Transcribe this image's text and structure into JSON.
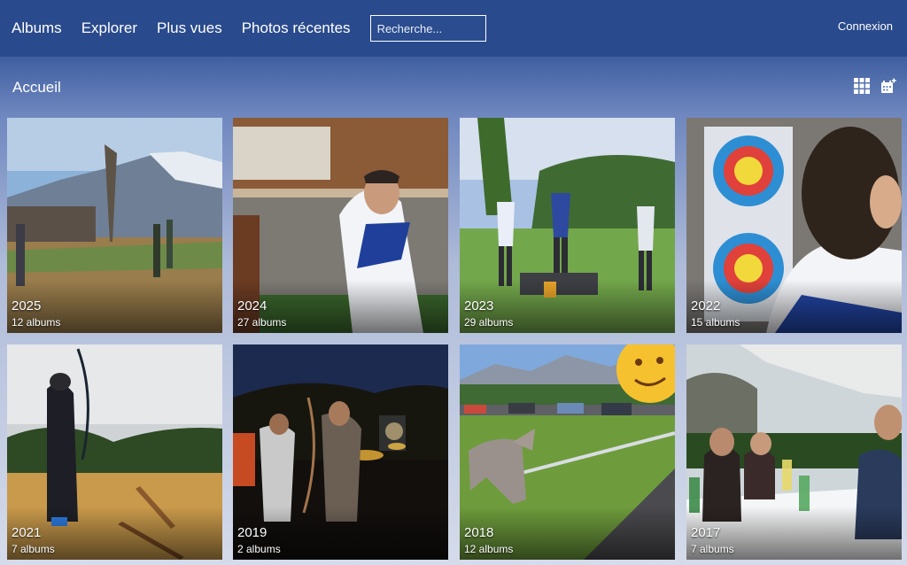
{
  "nav": {
    "links": [
      "Albums",
      "Explorer",
      "Plus vues",
      "Photos récentes"
    ],
    "search_placeholder": "Recherche...",
    "login": "Connexion"
  },
  "breadcrumb": "Accueil",
  "toolbar": {
    "grid_icon": "grid-view-icon",
    "calendar_icon": "calendar-add-icon"
  },
  "albums": [
    {
      "year": "2025",
      "count": "12 albums"
    },
    {
      "year": "2024",
      "count": "27 albums"
    },
    {
      "year": "2023",
      "count": "29 albums"
    },
    {
      "year": "2022",
      "count": "15 albums"
    },
    {
      "year": "2021",
      "count": "7 albums"
    },
    {
      "year": "2019",
      "count": "2 albums"
    },
    {
      "year": "2018",
      "count": "12 albums"
    },
    {
      "year": "2017",
      "count": "7 albums"
    }
  ],
  "colors": {
    "header": "#294a8c",
    "accent": "#ffffff"
  }
}
